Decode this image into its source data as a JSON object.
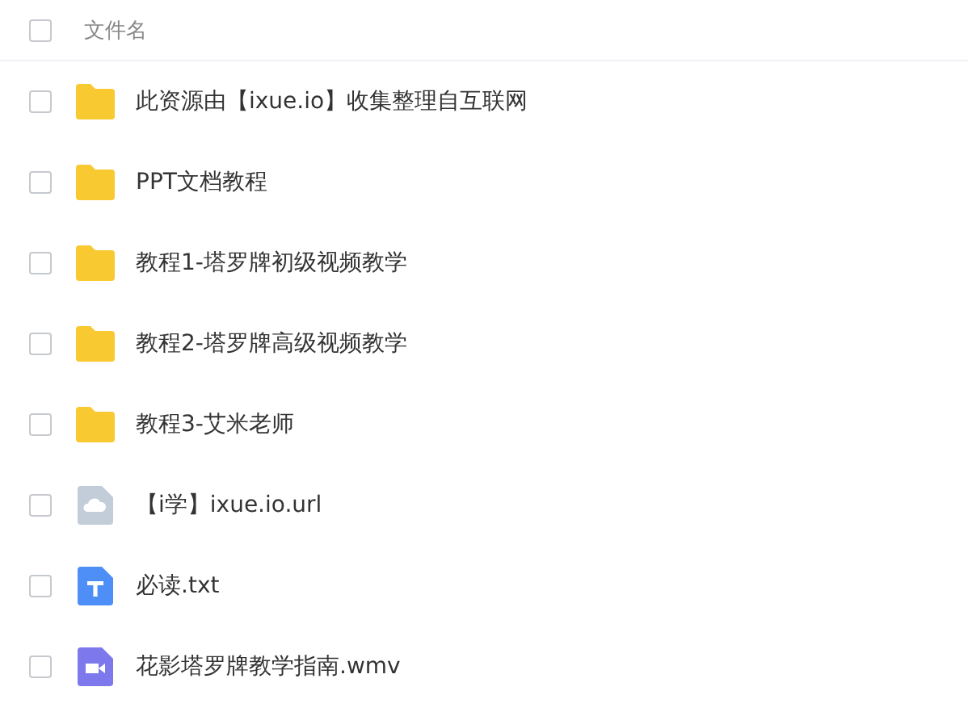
{
  "header": {
    "label": "文件名",
    "checked": false
  },
  "files": [
    {
      "kind": "folder",
      "name": "此资源由【ixue.io】收集整理自互联网",
      "checked": false
    },
    {
      "kind": "folder",
      "name": "PPT文档教程",
      "checked": false
    },
    {
      "kind": "folder",
      "name": "教程1-塔罗牌初级视频教学",
      "checked": false
    },
    {
      "kind": "folder",
      "name": "教程2-塔罗牌高级视频教学",
      "checked": false
    },
    {
      "kind": "folder",
      "name": "教程3-艾米老师",
      "checked": false
    },
    {
      "kind": "link",
      "name": "【i学】ixue.io.url",
      "checked": false
    },
    {
      "kind": "text",
      "name": "必读.txt",
      "checked": false
    },
    {
      "kind": "video",
      "name": "花影塔罗牌教学指南.wmv",
      "checked": false
    }
  ]
}
